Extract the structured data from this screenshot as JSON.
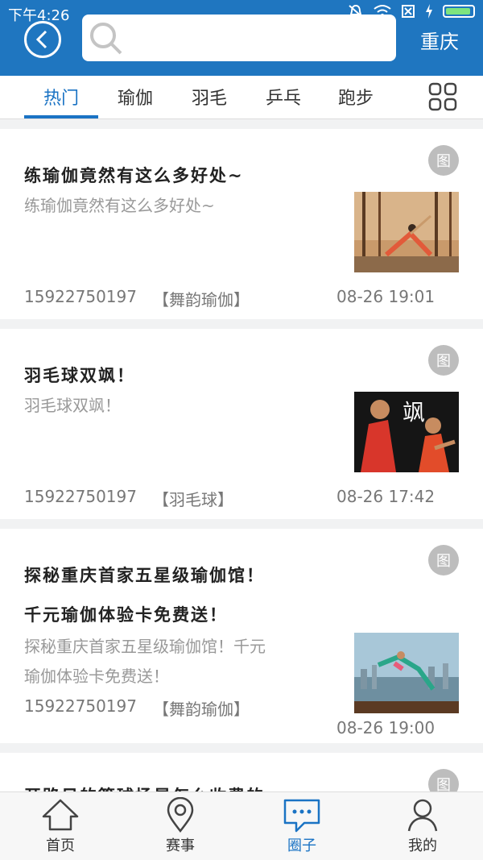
{
  "status_bar": {
    "time": "下午4:26"
  },
  "header": {
    "city": "重庆",
    "search_placeholder": ""
  },
  "tabs": [
    {
      "label": "热门",
      "active": true
    },
    {
      "label": "瑜伽"
    },
    {
      "label": "羽毛"
    },
    {
      "label": "乒乓"
    },
    {
      "label": "跑步"
    }
  ],
  "posts": [
    {
      "badge": "图",
      "title": "练瑜伽竟然有这么多好处~",
      "summary": "练瑜伽竟然有这么多好处~",
      "author": "15922750197",
      "tag": "【舞韵瑜伽】",
      "time": "08-26 19:01"
    },
    {
      "badge": "图",
      "title": "羽毛球双飒！",
      "summary": "羽毛球双飒！",
      "author": "15922750197",
      "tag": "【羽毛球】",
      "time": "08-26 17:42",
      "thumb_text": "飒"
    },
    {
      "badge": "图",
      "title_line1": "探秘重庆首家五星级瑜伽馆！",
      "title_line2": "千元瑜伽体验卡免费送！",
      "summary_line1": "探秘重庆首家五星级瑜伽馆！千元",
      "summary_line2": "瑜伽体验卡免费送！",
      "author": "15922750197",
      "tag": "【舞韵瑜伽】",
      "time": "08-26 19:00"
    },
    {
      "badge": "图",
      "title": "开路日的篮球场是怎么收费的"
    }
  ],
  "bottom_nav": [
    {
      "label": "首页",
      "icon": "home-icon"
    },
    {
      "label": "赛事",
      "icon": "location-pin-icon"
    },
    {
      "label": "圈子",
      "icon": "chat-bubble-icon",
      "active": true
    },
    {
      "label": "我的",
      "icon": "user-icon"
    }
  ],
  "colors": {
    "primary": "#1f76c0",
    "active": "#1a73c4"
  }
}
